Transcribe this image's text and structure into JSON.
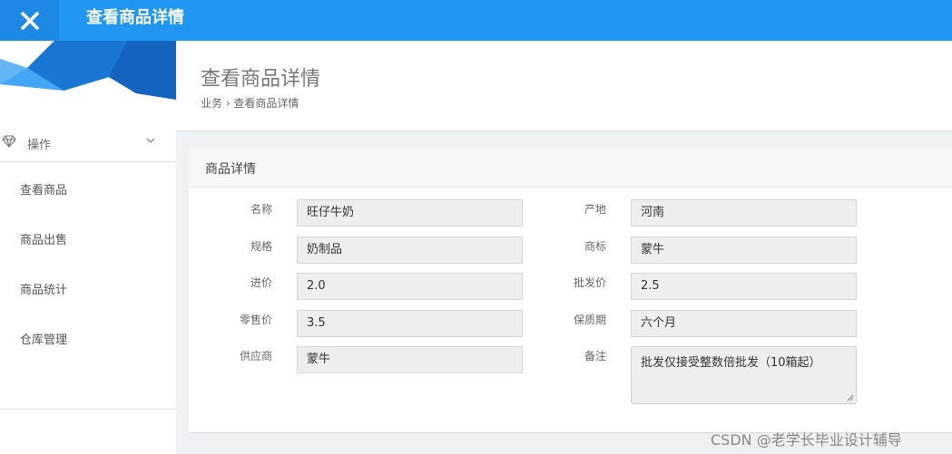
{
  "topbar": {
    "title": "查看商品详情"
  },
  "sidebar": {
    "group_label": "操作",
    "items": [
      {
        "label": "查看商品"
      },
      {
        "label": "商品出售"
      },
      {
        "label": "商品统计"
      },
      {
        "label": "仓库管理"
      }
    ]
  },
  "header": {
    "title": "查看商品详情",
    "breadcrumb": "业务 › 查看商品详情"
  },
  "panel": {
    "title": "商品详情",
    "fields": {
      "name": {
        "label": "名称",
        "value": "旺仔牛奶"
      },
      "origin": {
        "label": "产地",
        "value": "河南"
      },
      "spec": {
        "label": "规格",
        "value": "奶制品"
      },
      "brand": {
        "label": "商标",
        "value": "蒙牛"
      },
      "purchase_price": {
        "label": "进价",
        "value": "2.0"
      },
      "wholesale_price": {
        "label": "批发价",
        "value": "2.5"
      },
      "retail_price": {
        "label": "零售价",
        "value": "3.5"
      },
      "shelf_life": {
        "label": "保质期",
        "value": "六个月"
      },
      "supplier": {
        "label": "供应商",
        "value": "蒙牛"
      },
      "remark": {
        "label": "备注",
        "value": "批发仅接受整数倍批发（10箱起）"
      }
    }
  },
  "watermark": "CSDN @老学长毕业设计辅导",
  "colors": {
    "accent": "#2196f3",
    "accent_dark": "#1e88e5",
    "field_bg": "#eeeeee"
  }
}
